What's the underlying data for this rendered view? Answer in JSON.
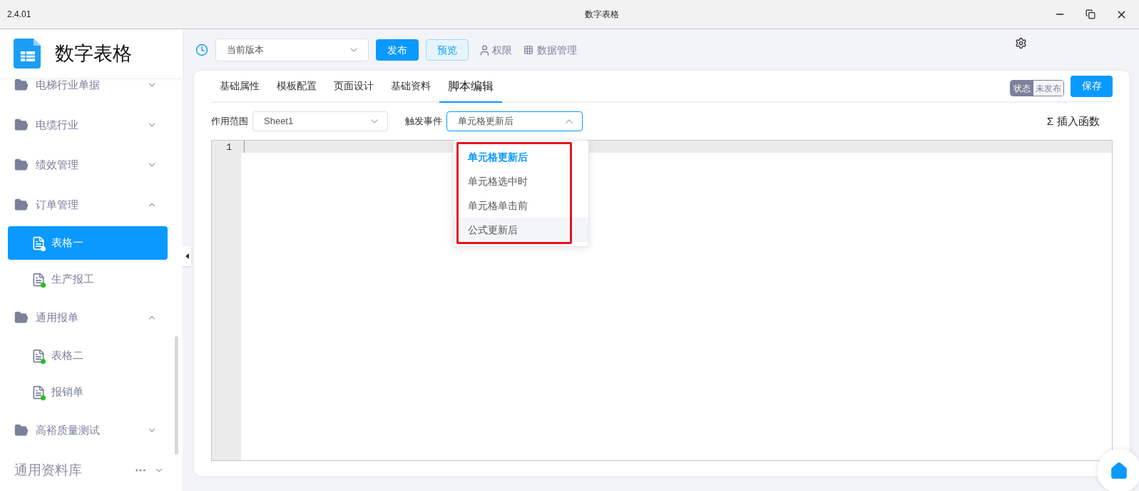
{
  "title_bar": {
    "version": "2.4.01",
    "title": "数字表格"
  },
  "sidebar": {
    "app_name": "数字表格",
    "items": [
      {
        "label": "电梯行业单据",
        "expanded": false
      },
      {
        "label": "电缆行业",
        "expanded": false
      },
      {
        "label": "绩效管理",
        "expanded": false
      },
      {
        "label": "订单管理",
        "expanded": true,
        "children": [
          {
            "label": "表格一",
            "selected": true
          },
          {
            "label": "生产报工",
            "selected": false
          }
        ]
      },
      {
        "label": "通用报单",
        "expanded": true,
        "children": [
          {
            "label": "表格二",
            "selected": false
          },
          {
            "label": "报销单",
            "selected": false
          }
        ]
      },
      {
        "label": "高裕质量测试",
        "expanded": false
      }
    ],
    "library": {
      "label": "通用资料库",
      "expanded": false
    }
  },
  "toolbar": {
    "version_select": "当前版本",
    "publish": "发布",
    "preview": "预览",
    "permissions": "权限",
    "data_management": "数据管理"
  },
  "tabs": [
    {
      "label": "基础属性",
      "selected": false
    },
    {
      "label": "模板配置",
      "selected": false
    },
    {
      "label": "页面设计",
      "selected": false
    },
    {
      "label": "基础资料",
      "selected": false
    },
    {
      "label": "脚本编辑",
      "selected": true
    }
  ],
  "status": {
    "label": "状态",
    "value": "未发布"
  },
  "save": "保存",
  "scope": {
    "label": "作用范围",
    "value": "Sheet1"
  },
  "trigger": {
    "label": "触发事件",
    "value": "单元格更新后",
    "expanded": true,
    "options": [
      {
        "label": "单元格更新后",
        "selected": true,
        "hovered": false
      },
      {
        "label": "单元格选中时",
        "selected": false,
        "hovered": false
      },
      {
        "label": "单元格单击前",
        "selected": false,
        "hovered": false
      },
      {
        "label": "公式更新后",
        "selected": false,
        "hovered": true
      }
    ]
  },
  "insert_function": {
    "symbol": "Σ",
    "label": "插入函数"
  },
  "editor": {
    "line_numbers": [
      "1"
    ]
  }
}
